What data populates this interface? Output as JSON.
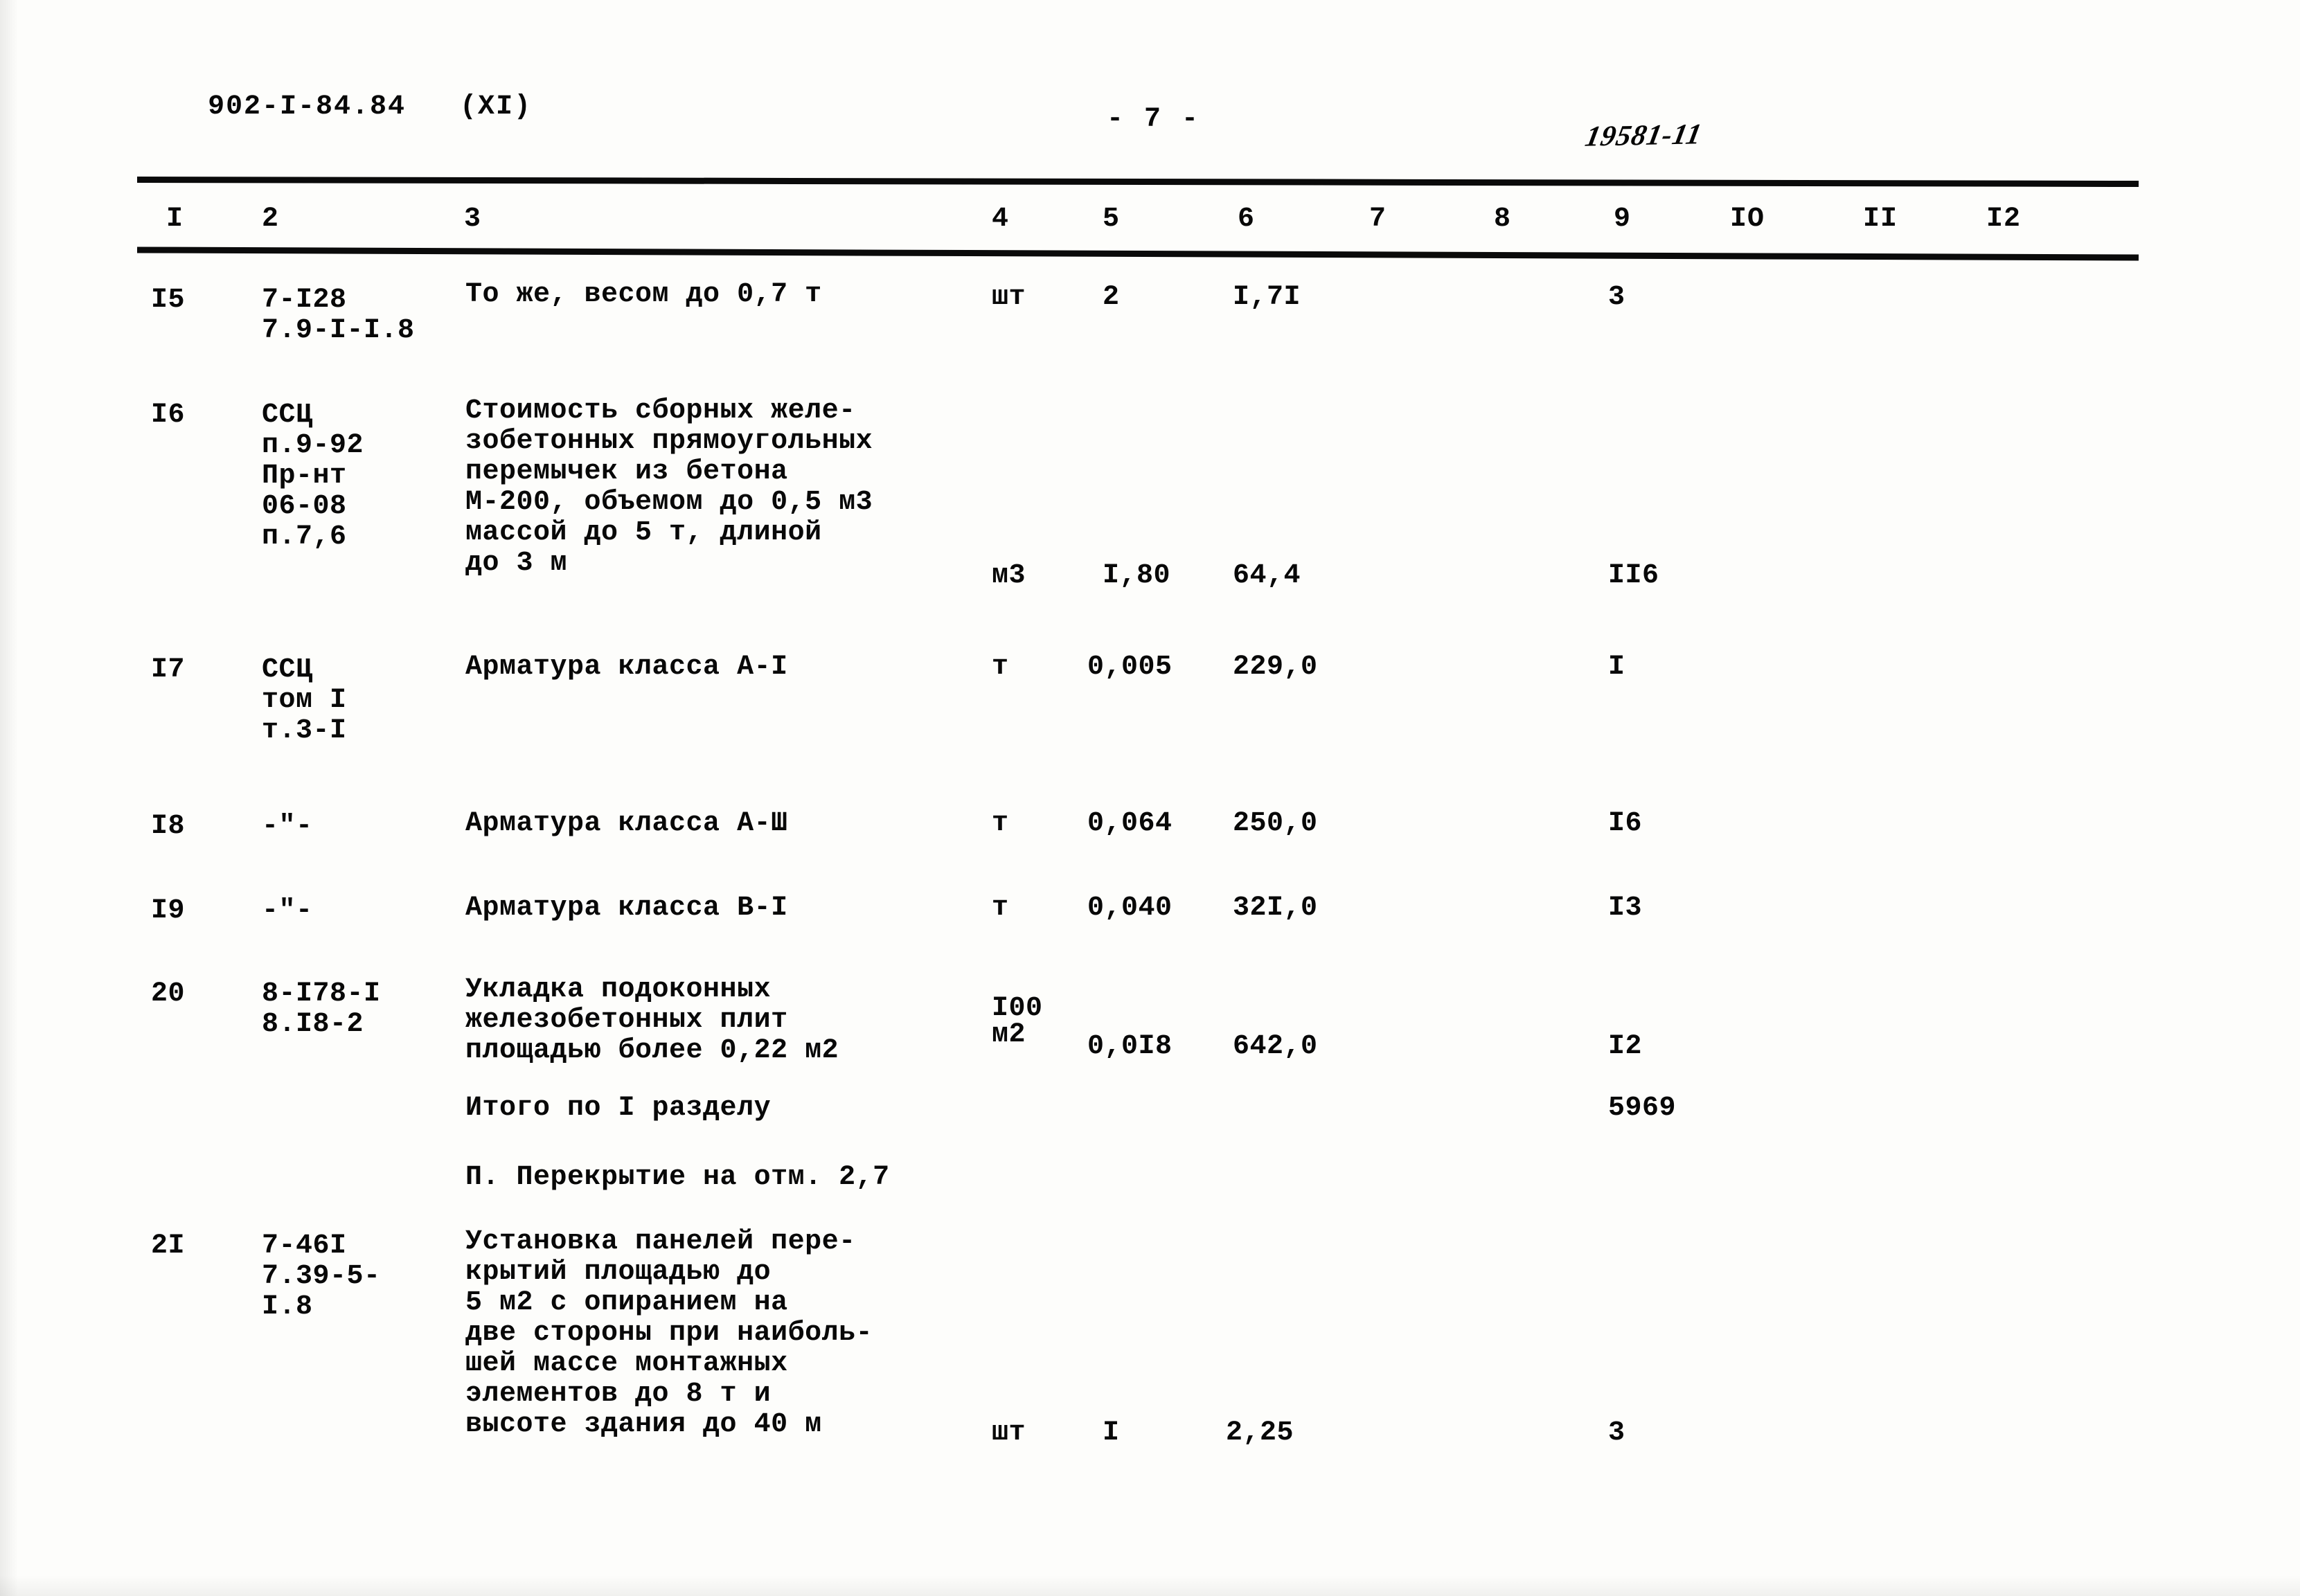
{
  "header": {
    "doc_code": "902-I-84.84   (XI)",
    "page_number": "- 7 -",
    "stamp_number": "19581-11"
  },
  "table": {
    "column_headers": [
      "I",
      "2",
      "3",
      "4",
      "5",
      "6",
      "7",
      "8",
      "9",
      "IO",
      "II",
      "I2"
    ],
    "rows": [
      {
        "num": "I5",
        "code": "7-I28\n7.9-I-I.8",
        "description": "То же, весом до 0,7 т",
        "unit": "шт",
        "quantity": "2",
        "price": "I,7I",
        "col7": "",
        "col8": "",
        "total": "3"
      },
      {
        "num": "I6",
        "code": "ССЦ\nп.9-92\nПр-нт\n06-08\nп.7,6",
        "description": "Стоимость сборных желе-\nзобетонных прямоугольных\nперемычек из бетона\nМ-200, объемом до 0,5 м3\nмассой до 5 т, длиной\nдо 3 м",
        "unit": "м3",
        "quantity": "I,80",
        "price": "64,4",
        "col7": "",
        "col8": "",
        "total": "II6"
      },
      {
        "num": "I7",
        "code": "ССЦ\nтом I\nт.3-I",
        "description": "Арматура класса А-I",
        "unit": "т",
        "quantity": "0,005",
        "price": "229,0",
        "col7": "",
        "col8": "",
        "total": "I"
      },
      {
        "num": "I8",
        "code": "-\"-",
        "description": "Арматура класса А-Ш",
        "unit": "т",
        "quantity": "0,064",
        "price": "250,0",
        "col7": "",
        "col8": "",
        "total": "I6"
      },
      {
        "num": "I9",
        "code": "-\"-",
        "description": "Арматура класса В-I",
        "unit": "т",
        "quantity": "0,040",
        "price": "32I,0",
        "col7": "",
        "col8": "",
        "total": "I3"
      },
      {
        "num": "20",
        "code": "8-I78-I\n8.I8-2",
        "description": "Укладка подоконных\nжелезобетонных плит\nплощадью более 0,22 м2",
        "unit": "I00\nм2",
        "quantity": "0,0I8",
        "price": "642,0",
        "col7": "",
        "col8": "",
        "total": "I2"
      },
      {
        "num": "2I",
        "code": "7-46I\n7.39-5-\nI.8",
        "description": "Установка панелей пере-\nкрытий площадью до\n5 м2 с опиранием на\nдве стороны при наиболь-\nшей массе монтажных\nэлементов до 8 т и\nвысоте здания до 40 м",
        "unit": "шт",
        "quantity": "I",
        "price": "2,25",
        "col7": "",
        "col8": "",
        "total": "3"
      }
    ],
    "subtotal": {
      "label": "Итого по I разделу",
      "value": "5969"
    },
    "section_heading": "П. Перекрытие на отм. 2,7"
  }
}
